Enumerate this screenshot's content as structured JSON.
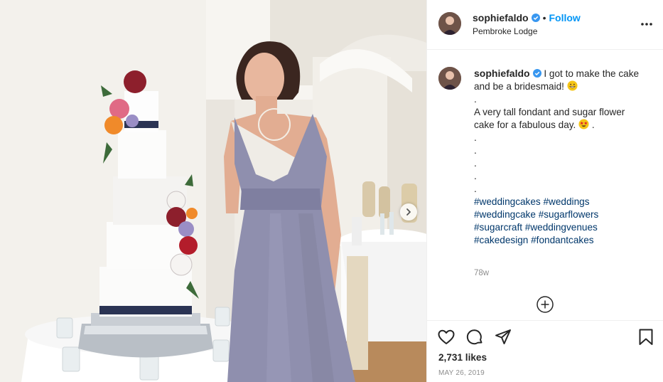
{
  "post": {
    "username": "sophiefaldo",
    "follow_label": "Follow",
    "separator": "•",
    "location": "Pembroke Lodge",
    "caption": {
      "line1": "I got to make the cake",
      "line2": "and be a bridesmaid!",
      "dot": ".",
      "line3": "A very tall fondant and sugar flower",
      "line4": "cake for a fabulous day.",
      "line4_end": " ."
    },
    "hashtags": [
      "#weddingcakes",
      "#weddings",
      "#weddingcake",
      "#sugarflowers",
      "#sugarcraft",
      "#weddingvenues",
      "#cakedesign",
      "#fondantcakes"
    ],
    "time_ago": "78w",
    "likes": "2,731 likes",
    "date": "MAY 26, 2019"
  },
  "icons": {
    "verified": "verified-badge-icon",
    "more": "more-options-icon",
    "add_comment": "add-comment-icon",
    "like": "heart-icon",
    "comment": "comment-icon",
    "share": "share-icon",
    "save": "bookmark-icon",
    "next": "chevron-right-icon"
  },
  "colors": {
    "link": "#0095f6",
    "hashtag": "#00376b",
    "muted": "#8e8e8e",
    "text": "#262626"
  }
}
